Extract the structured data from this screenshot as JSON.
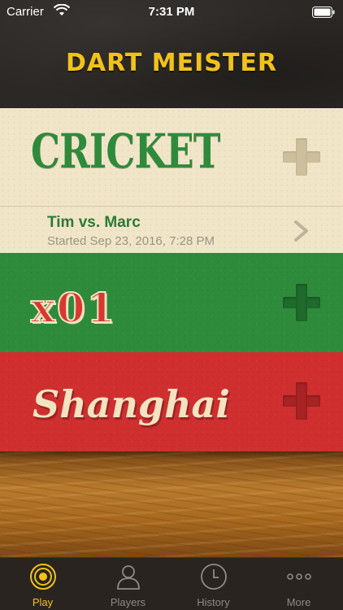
{
  "status_bar": {
    "carrier": "Carrier",
    "time": "7:31 PM"
  },
  "header": {
    "title": "DART MEISTER",
    "title_color": "#f2c21a"
  },
  "games": [
    {
      "name": "CRICKET",
      "color": "#f1e5c8",
      "add_icon": "plus-icon",
      "in_progress": [
        {
          "title": "Tim vs. Marc",
          "subtitle": "Started Sep 23, 2016, 7:28 PM",
          "icon": "chevron-right-icon"
        }
      ]
    },
    {
      "name": "x01",
      "color": "#2e8b3b",
      "add_icon": "plus-icon"
    },
    {
      "name": "Shanghai",
      "color": "#cf2f2f",
      "add_icon": "plus-icon"
    }
  ],
  "tabs": [
    {
      "label": "Play",
      "icon": "target-icon",
      "active": true
    },
    {
      "label": "Players",
      "icon": "person-icon",
      "active": false
    },
    {
      "label": "History",
      "icon": "clock-icon",
      "active": false
    },
    {
      "label": "More",
      "icon": "ellipsis-icon",
      "active": false
    }
  ],
  "colors": {
    "accent": "#f2c21a",
    "cricket_green": "#2c7a35",
    "tab_inactive": "#8f8a84"
  }
}
